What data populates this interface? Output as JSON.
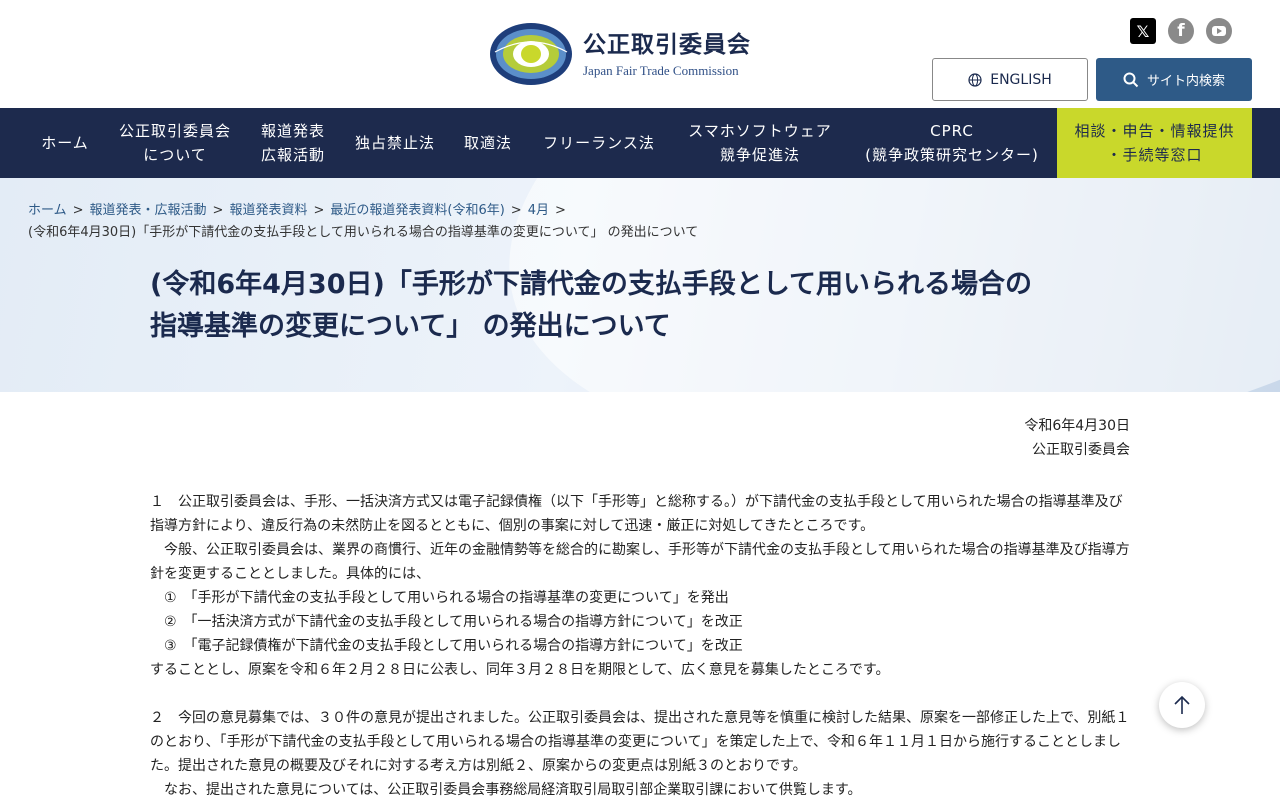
{
  "header": {
    "logo_ja": "公正取引委員会",
    "logo_en": "Japan Fair Trade Commission",
    "english_label": "ENGLISH",
    "search_label": "サイト内検索",
    "social": [
      "x-icon",
      "facebook-icon",
      "youtube-icon"
    ]
  },
  "nav": {
    "items": [
      {
        "line1": "ホーム",
        "line2": ""
      },
      {
        "line1": "公正取引委員会",
        "line2": "について"
      },
      {
        "line1": "報道発表",
        "line2": "広報活動"
      },
      {
        "line1": "独占禁止法",
        "line2": ""
      },
      {
        "line1": "取適法",
        "line2": ""
      },
      {
        "line1": "フリーランス法",
        "line2": ""
      },
      {
        "line1": "スマホソフトウェア",
        "line2": "競争促進法"
      },
      {
        "line1": "CPRC",
        "line2": "(競争政策研究センター)"
      },
      {
        "line1": "相談・申告・情報提供",
        "line2": "・手続等窓口"
      }
    ]
  },
  "breadcrumb": {
    "items": [
      "ホーム",
      "報道発表・広報活動",
      "報道発表資料",
      "最近の報道発表資料(令和6年)",
      "4月"
    ],
    "separator": ">",
    "current": "(令和6年4月30日)「手形が下請代金の支払手段として用いられる場合の指導基準の変更について」 の発出について"
  },
  "page": {
    "title_line1": "(令和6年4月30日)「手形が下請代金の支払手段として用いられる場合の",
    "title_line2": "指導基準の変更について」 の発出について",
    "date": "令和6年4月30日",
    "org": "公正取引委員会"
  },
  "content": {
    "p1": "１　公正取引委員会は、手形、一括決済方式又は電子記録債権（以下「手形等」と総称する。）が下請代金の支払手段として用いられた場合の指導基準及び指導方針により、違反行為の未然防止を図るとともに、個別の事案に対して迅速・厳正に対処してきたところです。",
    "p2": "　今般、公正取引委員会は、業界の商慣行、近年の金融情勢等を総合的に勘案し、手形等が下請代金の支払手段として用いられた場合の指導基準及び指導方針を変更することとしました。具体的には、",
    "li1": "　①　「手形が下請代金の支払手段として用いられる場合の指導基準の変更について」を発出",
    "li2": "　②　「一括決済方式が下請代金の支払手段として用いられる場合の指導方針について」を改正",
    "li3": "　③　「電子記録債権が下請代金の支払手段として用いられる場合の指導方針について」を改正",
    "p3": "することとし、原案を令和６年２月２８日に公表し、同年３月２８日を期限として、広く意見を募集したところです。",
    "p4": "２　今回の意見募集では、３０件の意見が提出されました。公正取引委員会は、提出された意見等を慎重に検討した結果、原案を一部修正した上で、別紙１のとおり、「手形が下請代金の支払手段として用いられる場合の指導基準の変更について」を策定した上で、令和６年１１月１日から施行することとしました。提出された意見の概要及びそれに対する考え方は別紙２、原案からの変更点は別紙３のとおりです。",
    "p5": "　なお、提出された意見については、公正取引委員会事務総局経済取引局取引部企業取引課において供覧します。"
  },
  "colors": {
    "nav_bg": "#1d2a4d",
    "nav_highlight": "#c9d82b",
    "accent_blue": "#2e5a87",
    "title": "#1b2a4e"
  }
}
